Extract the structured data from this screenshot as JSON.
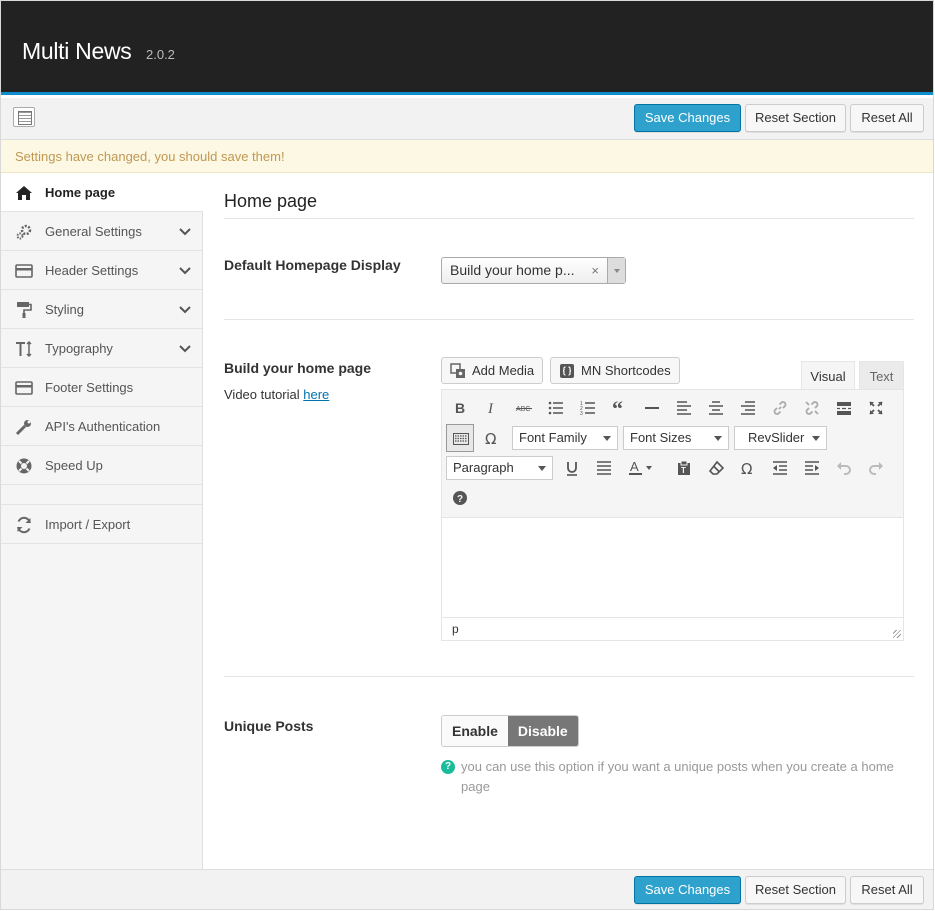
{
  "header": {
    "title": "Multi News",
    "version": "2.0.2"
  },
  "actions": {
    "save": "Save Changes",
    "reset_section": "Reset Section",
    "reset_all": "Reset All"
  },
  "notice": "Settings have changed, you should save them!",
  "sidebar": {
    "items": [
      {
        "label": "Home page",
        "icon": "home-icon",
        "active": true
      },
      {
        "label": "General Settings",
        "icon": "gears-icon",
        "expandable": true
      },
      {
        "label": "Header Settings",
        "icon": "credit-card-icon",
        "expandable": true
      },
      {
        "label": "Styling",
        "icon": "paint-roller-icon",
        "expandable": true
      },
      {
        "label": "Typography",
        "icon": "text-height-icon",
        "expandable": true
      },
      {
        "label": "Footer Settings",
        "icon": "credit-card-icon"
      },
      {
        "label": "API's Authentication",
        "icon": "wrench-icon"
      },
      {
        "label": "Speed Up",
        "icon": "life-ring-icon"
      },
      {
        "label": "Import / Export",
        "icon": "refresh-icon"
      }
    ]
  },
  "main": {
    "title": "Home page",
    "default_display": {
      "label": "Default Homepage Display",
      "value": "Build your home p...",
      "clear": "×"
    },
    "builder": {
      "label": "Build your home page",
      "sub_prefix": "Video tutorial ",
      "sub_link": "here",
      "add_media": "Add Media",
      "shortcodes": "MN Shortcodes",
      "tab_visual": "Visual",
      "tab_text": "Text",
      "font_family": "Font Family",
      "font_sizes": "Font Sizes",
      "revslider": "RevSlider",
      "format": "Paragraph",
      "status_path": "p"
    },
    "unique_posts": {
      "label": "Unique Posts",
      "enable": "Enable",
      "disable": "Disable",
      "selected": "Disable",
      "help": "you can use this option if you want a unique posts when you create a home page"
    }
  },
  "colors": {
    "accent": "#2ea2cc",
    "topbar": "#222222",
    "notice_text": "#c09853",
    "help_icon": "#1bbc9b"
  }
}
